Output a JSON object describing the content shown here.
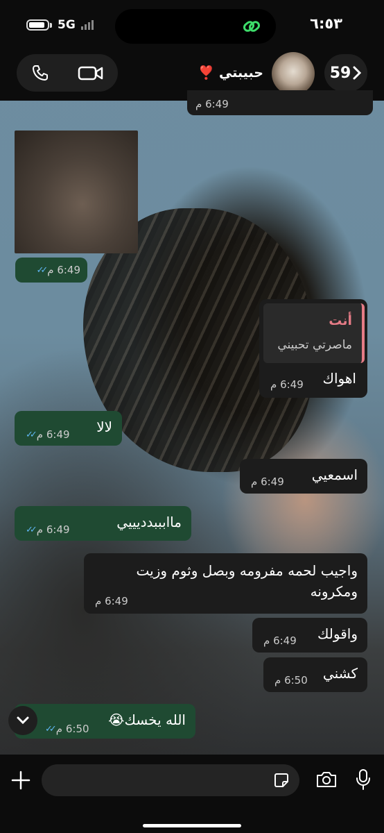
{
  "status_bar": {
    "time": "٦:٥٣",
    "network": "5G"
  },
  "header": {
    "contact_name": "حبيبتي ❣️",
    "unread_count": "59"
  },
  "messages": [
    {
      "time": "6:49 م"
    },
    {
      "time": "6:49 م"
    },
    {
      "reply_author": "أنت",
      "reply_text": "ماصرتي تحبيني",
      "text": "اهواك",
      "time": "6:49 م"
    },
    {
      "text": "لالا",
      "time": "6:49 م"
    },
    {
      "text": "اسمعيي",
      "time": "6:49 م"
    },
    {
      "text": "ماابببدديييي",
      "time": "6:49 م"
    },
    {
      "text": "واجيب لحمه مفرومه وبصل وثوم وزيت ومكرونه",
      "time": "6:49 م"
    },
    {
      "text": "واقولك",
      "time": "6:49 م"
    },
    {
      "text": "كشني",
      "time": "6:50 م"
    },
    {
      "text": "الله يخسك😭",
      "time": "6:50 م"
    }
  ],
  "colors": {
    "read_ticks": "#5fb6f2",
    "reply_accent": "#e57b86",
    "outgoing": "#1f4a32"
  }
}
